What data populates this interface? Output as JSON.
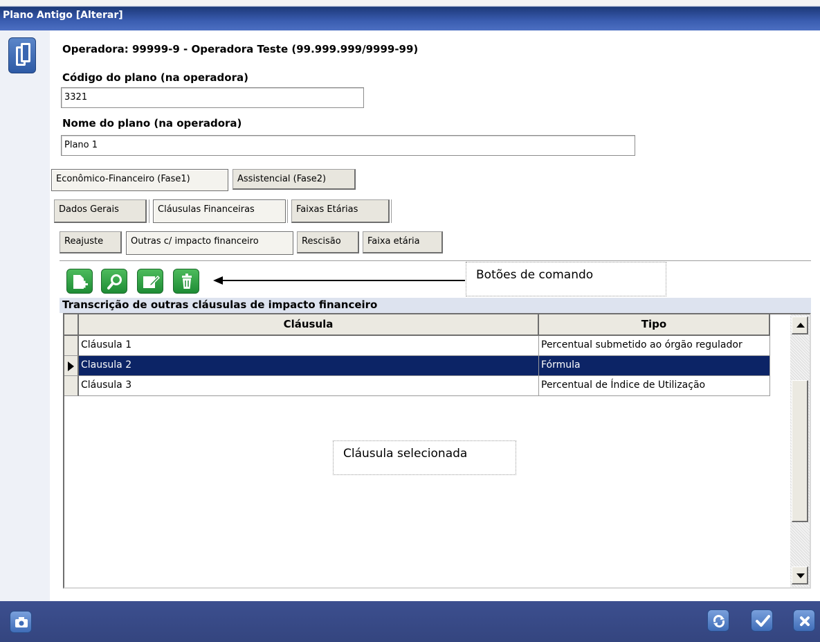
{
  "window": {
    "title": "Plano Antigo [Alterar]"
  },
  "form": {
    "operadora_line": "Operadora:  99999-9 - Operadora Teste  (99.999.999/9999-99)",
    "codigo_label": "Código do plano (na operadora)",
    "codigo_value": "3321",
    "nome_label": "Nome do plano (na operadora)",
    "nome_value": "Plano 1"
  },
  "tabs": {
    "level1": [
      "Econômico-Financeiro (Fase1)",
      "Assistencial (Fase2)"
    ],
    "level2": [
      "Dados Gerais",
      "Cláusulas Financeiras",
      "Faixas Etárias"
    ],
    "level3": [
      "Reajuste",
      "Outras c/ impacto financeiro",
      "Rescisão",
      "Faixa etária"
    ]
  },
  "toolbar": {
    "icons": [
      "add-icon",
      "search-icon",
      "edit-icon",
      "delete-icon"
    ]
  },
  "annotations": {
    "buttons_callout": "Botões de comando",
    "selected_callout": "Cláusula selecionada"
  },
  "grid": {
    "section_title": "Transcrição de outras cláusulas de impacto financeiro",
    "columns": [
      "Cláusula",
      "Tipo"
    ],
    "rows": [
      {
        "clausula": "Cláusula 1",
        "tipo": "Percentual submetido ao órgão regulador",
        "selected": false
      },
      {
        "clausula": "Clausula 2",
        "tipo": "Fórmula",
        "selected": true
      },
      {
        "clausula": "Cláusula 3",
        "tipo": "Percentual de Índice de Utilização",
        "selected": false
      }
    ]
  },
  "footer": {
    "icons": [
      "camera-icon",
      "refresh-icon",
      "check-icon",
      "close-icon"
    ]
  },
  "colors": {
    "title_bar": "#2b4a95",
    "selection": "#0c2466",
    "command_button": "#2e9a44",
    "bottom_bar": "#3c4f8f"
  }
}
